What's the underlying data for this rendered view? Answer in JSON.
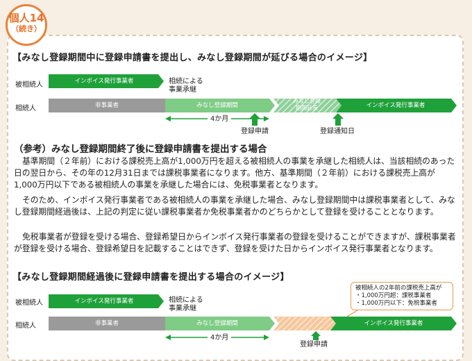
{
  "badge": {
    "number": "個人14",
    "continued": "（続き）"
  },
  "diagram1": {
    "title": "【みなし登録期間中に登録申請書を提出し、みなし登録期間が延びる場合のイメージ】",
    "heir_label": "相続人",
    "decedent_label": "被相続人",
    "decedent_bar": "インボイス発行事業者",
    "succession_label": [
      "相続による",
      "事業承継"
    ],
    "non_business_bar": "非事業者",
    "deemed_period_bar": "みなし登録期間",
    "extended_period_bar": [
      "みなし登録",
      "期間延長"
    ],
    "invoice_issuer_bar": "インボイス発行事業者",
    "four_months": "4か月",
    "application": "登録申請",
    "notice_date": "登録通知日"
  },
  "reference": {
    "heading": "（参考）みなし登録期間終了後に登録申請書を提出する場合",
    "para1": "基準期間（２年前）における課税売上高が1,000万円を超える被相続人の事業を承継した相続人は、当該相続のあった日の翌日から、その年の12月31日までは課税事業者になります。他方、基準期間（２年前）における課税売上高が1,000万円以下である被相続人の事業を承継した場合には、免税事業者となります。",
    "para2": "そのため、インボイス発行事業者である被相続人の事業を承継した場合、みなし登録期間中は課税事業者として、みなし登録期間経過後は、上記の判定に従い課税事業者か免税事業者かのどちらかとして登録を受けることとなります。",
    "para3": "免税事業者が登録を受ける場合、登録希望日からインボイス発行事業者の登録を受けることができますが、課税事業者が登録を受ける場合、登録希望日を記載することはできず、登録を受けた日からインボイス発行事業者となります。"
  },
  "diagram2": {
    "title": "【みなし登録期間経過後に登録申請書を提出する場合のイメージ】",
    "heir_label": "相続人",
    "decedent_label": "被相続人",
    "decedent_bar": "インボイス発行事業者",
    "succession_label": [
      "相続による",
      "事業承継"
    ],
    "non_business_bar": "非事業者",
    "deemed_period_bar": "みなし登録期間",
    "invoice_issuer_bar": "インボイス発行事業者",
    "four_months": "4か月",
    "application": "登録申請",
    "note": [
      "被相続人の2年前の課税売上高が",
      "・1,000万円超：課税事業者",
      "・1,000万円以下：免税事業者"
    ]
  },
  "colors": {
    "green": "#1fa13a",
    "grey": "#9a9a9a",
    "orange": "#e8833a",
    "hatch": "#f6c79e"
  }
}
